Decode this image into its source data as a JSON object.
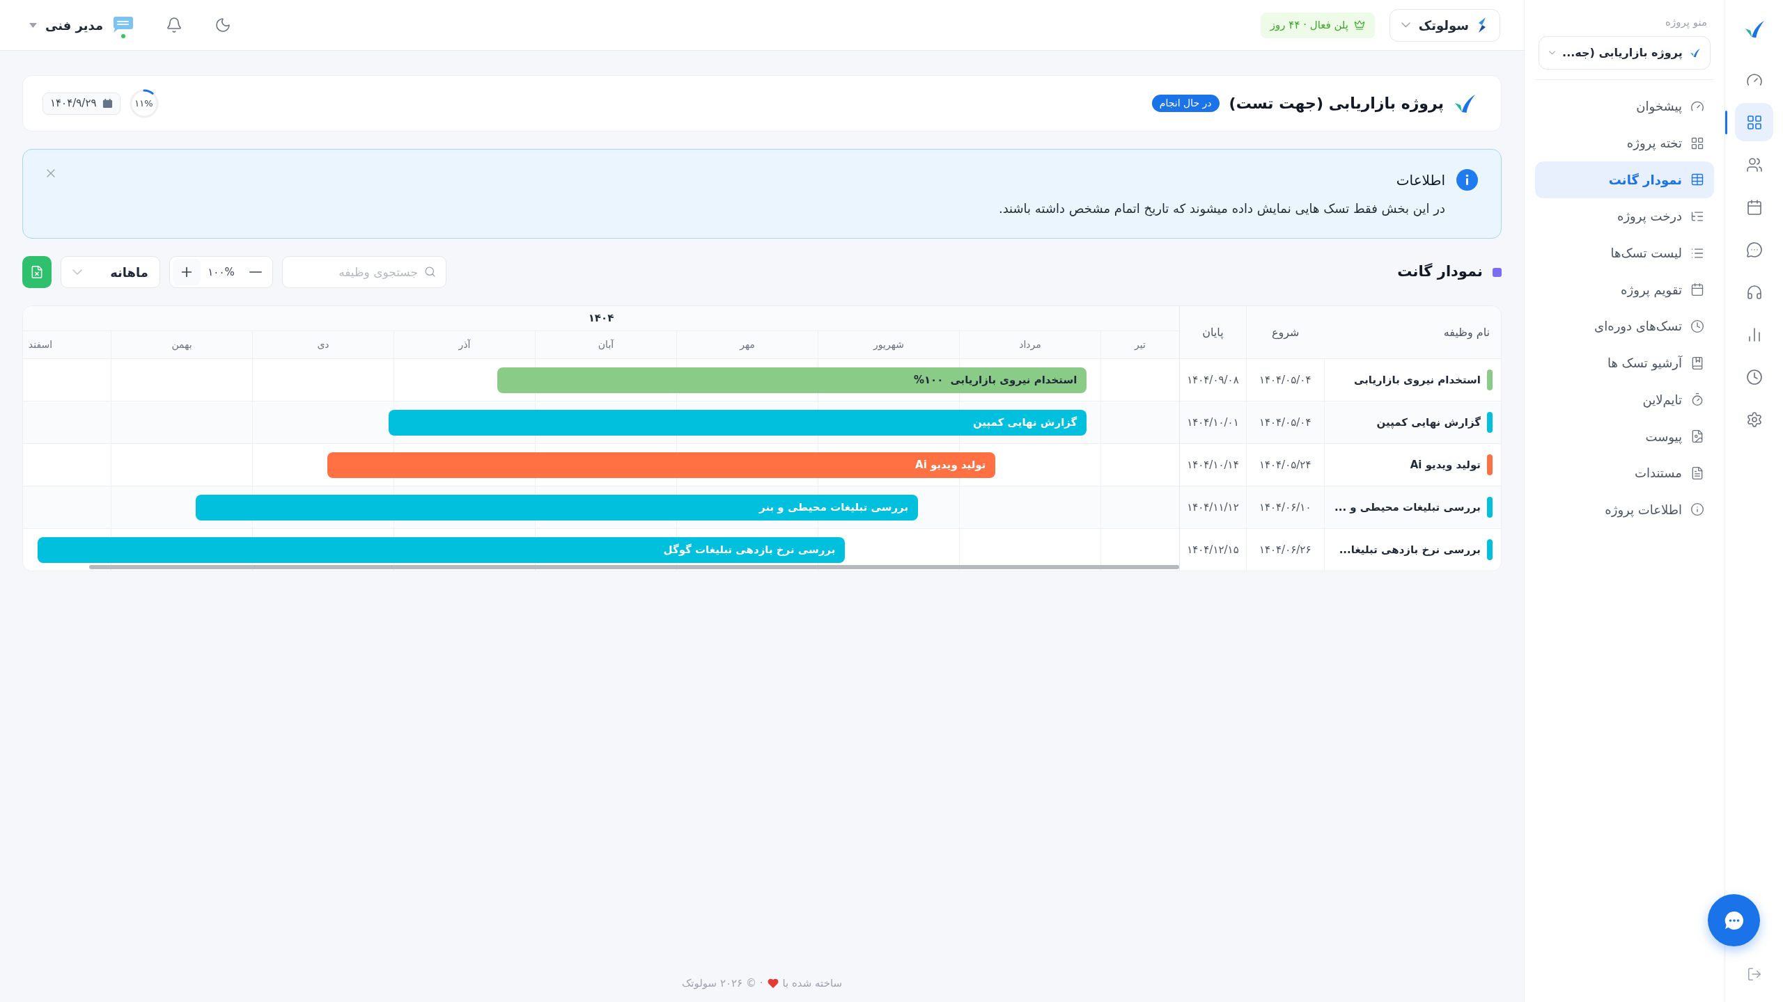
{
  "topbar": {
    "workspace": {
      "name": "سولوتک"
    },
    "plan": "پلن فعال · ۴۴ روز",
    "user": {
      "name": "مدیر فنی",
      "online": true
    }
  },
  "project": {
    "title": "پروژه بازاریابی (جهت تست)",
    "status": "در حال انجام",
    "progress": {
      "label": "۱۱%",
      "level": 0.11
    },
    "due_date": "۱۴۰۴/۹/۲۹"
  },
  "info_alert": {
    "title": "اطلاعات",
    "message": "در این بخش فقط تسک هایی نمایش داده میشوند که تاریخ اتمام مشخص داشته باشند."
  },
  "gantt": {
    "title": "نمودار گانت",
    "search": {
      "placeholder": "جستجوی وظیفه"
    },
    "zoom": "۱۰۰%",
    "view": "ماهانه",
    "columns": [
      "نام وظیفه",
      "شروع",
      "پایان"
    ],
    "year": "۱۴۰۴",
    "months": [
      "تیر",
      "مرداد",
      "شهریور",
      "مهر",
      "آبان",
      "آذر",
      "دی",
      "بهمن",
      "اسفند"
    ],
    "tasks": [
      {
        "name": "استخدام نیروی بازاریابی",
        "start": "۱۴۰۴/۰۵/۰۴",
        "end": "۱۴۰۴/۰۹/۰۸",
        "bar_label": "استخدام نیروی بازاریابی",
        "progress": "%۱۰۰",
        "color": "#8bcb88"
      },
      {
        "name": "گزارش نهایی کمپین",
        "start": "۱۴۰۴/۰۵/۰۴",
        "end": "۱۴۰۴/۱۰/۰۱",
        "bar_label": "گزارش نهایی کمپین",
        "color": "#00c0dd"
      },
      {
        "name": "تولید ویدیو Ai",
        "start": "۱۴۰۴/۰۵/۲۴",
        "end": "۱۴۰۴/۱۰/۱۴",
        "bar_label": "تولید ویدیو Ai",
        "color": "#ff7043"
      },
      {
        "name": "بررسی تبلیغات محیطی و ...",
        "start": "۱۴۰۴/۰۶/۱۰",
        "end": "۱۴۰۴/۱۱/۱۲",
        "bar_label": "بررسی تبلیغات محیطی و بنر",
        "color": "#00c0dd"
      },
      {
        "name": "بررسی نرخ بازدهی تبلیغا...",
        "start": "۱۴۰۴/۰۶/۲۶",
        "end": "۱۴۰۴/۱۲/۱۵",
        "bar_label": "بررسی نرخ بازدهی تبلیغات گوگل",
        "color": "#00c0dd"
      }
    ]
  },
  "footer": {
    "made_with": "ساخته شده با",
    "copyright": "· © ۲۰۲۶ سولوتک"
  },
  "project_menu": {
    "label": "منو پروژه",
    "project": "پروژه بازاریابی (جه...",
    "items": [
      {
        "label": "پیشخوان",
        "selected": false
      },
      {
        "label": "تخته پروژه",
        "selected": false
      },
      {
        "label": "نمودار گانت",
        "selected": true
      },
      {
        "label": "درخت پروژه",
        "selected": false
      },
      {
        "label": "لیست تسک‌ها",
        "selected": false
      },
      {
        "label": "تقویم پروژه",
        "selected": false
      },
      {
        "label": "تسک‌های دوره‌ای",
        "selected": false
      },
      {
        "label": "آرشیو تسک ها",
        "selected": false
      },
      {
        "label": "تایم‌لاین",
        "selected": false
      },
      {
        "label": "پیوست",
        "selected": false
      },
      {
        "label": "مستندات",
        "selected": false
      },
      {
        "label": "اطلاعات پروژه",
        "selected": false
      }
    ]
  },
  "rail": {
    "items": [
      {
        "selected": false
      },
      {
        "selected": true
      },
      {
        "selected": false
      },
      {
        "selected": false
      },
      {
        "selected": false
      },
      {
        "selected": false
      },
      {
        "selected": false
      },
      {
        "selected": false
      },
      {
        "selected": false
      }
    ]
  }
}
